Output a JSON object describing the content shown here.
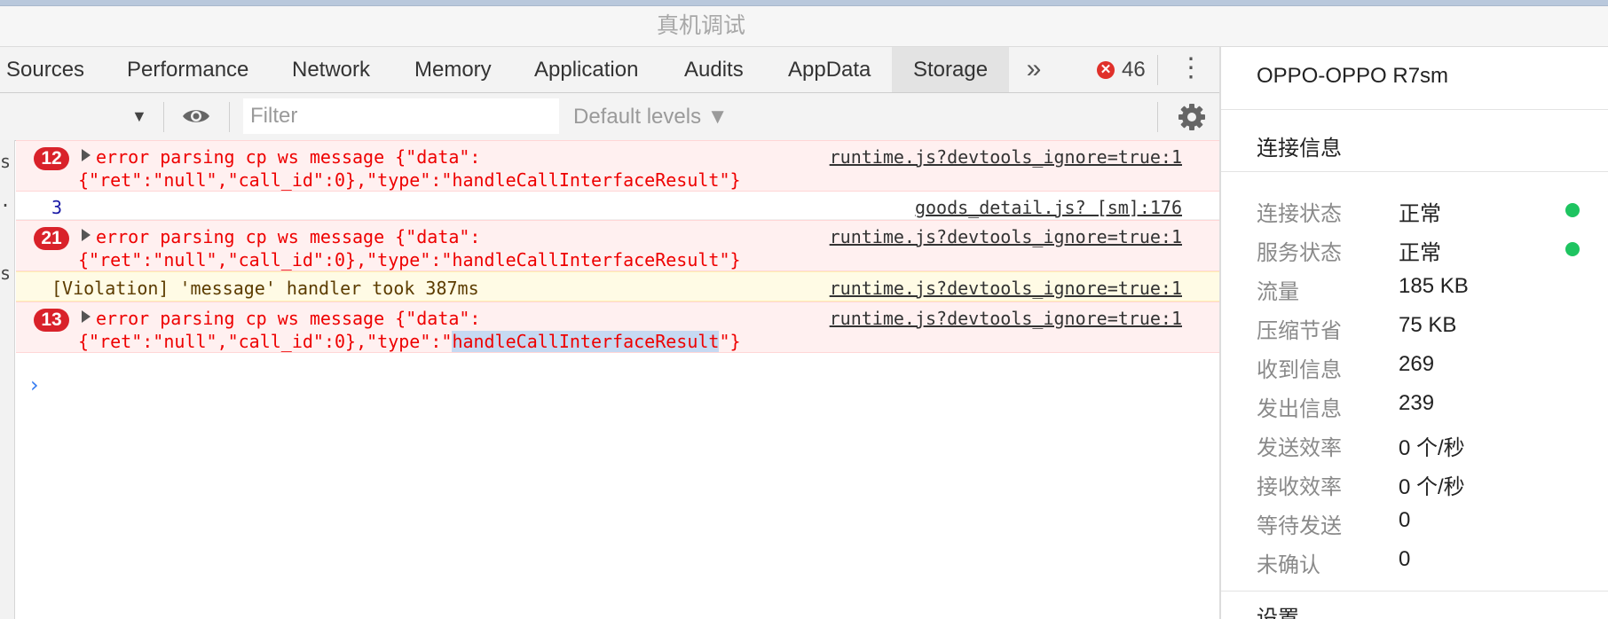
{
  "window": {
    "title": "真机调试"
  },
  "tabs": [
    {
      "label": "Sources"
    },
    {
      "label": "Performance"
    },
    {
      "label": "Network"
    },
    {
      "label": "Memory"
    },
    {
      "label": "Application"
    },
    {
      "label": "Audits"
    },
    {
      "label": "AppData"
    },
    {
      "label": "Storage",
      "active": true
    }
  ],
  "tabs_more": "»",
  "error_count": "46",
  "filter": {
    "placeholder": "Filter",
    "levels_label": "Default levels ▼"
  },
  "left_gutter": [
    "s",
    "..",
    "s"
  ],
  "console": {
    "messages": [
      {
        "type": "error",
        "count": "12",
        "line1": "error parsing cp ws message {\"data\":",
        "line2": "{\"ret\":\"null\",\"call_id\":0},\"type\":\"handleCallInterfaceResult\"}",
        "source": "runtime.js?devtools_ignore=true:1"
      },
      {
        "type": "log",
        "text": "3",
        "source": "goods_detail.js? [sm]:176"
      },
      {
        "type": "error",
        "count": "21",
        "line1": "error parsing cp ws message {\"data\":",
        "line2": "{\"ret\":\"null\",\"call_id\":0},\"type\":\"handleCallInterfaceResult\"}",
        "source": "runtime.js?devtools_ignore=true:1"
      },
      {
        "type": "warning",
        "text": "[Violation] 'message' handler took 387ms",
        "source": "runtime.js?devtools_ignore=true:1"
      },
      {
        "type": "error",
        "count": "13",
        "line1": "error parsing cp ws message {\"data\":",
        "line2_pre": "{\"ret\":\"null\",\"call_id\":0},\"type\":\"",
        "line2_selected": "handleCallInterfaceResult",
        "line2_post": "\"}",
        "source": "runtime.js?devtools_ignore=true:1"
      }
    ],
    "prompt": "›"
  },
  "sidepanel": {
    "device": "OPPO-OPPO R7sm",
    "section_title": "连接信息",
    "rows": [
      {
        "label": "连接状态",
        "value": "正常",
        "status": "ok"
      },
      {
        "label": "服务状态",
        "value": "正常",
        "status": "ok"
      },
      {
        "label": "流量",
        "value": "185 KB"
      },
      {
        "label": "压缩节省",
        "value": "75 KB"
      },
      {
        "label": "收到信息",
        "value": "269"
      },
      {
        "label": "发出信息",
        "value": "239"
      },
      {
        "label": "发送效率",
        "value": "0 个/秒"
      },
      {
        "label": "接收效率",
        "value": "0 个/秒"
      },
      {
        "label": "等待发送",
        "value": "0"
      },
      {
        "label": "未确认",
        "value": "0"
      }
    ],
    "next_section_title": "设置"
  },
  "colors": {
    "status_ok": "#1ec460",
    "error_badge": "#d9222a",
    "error_text": "#ee0000",
    "log_number": "#1a1aa6"
  }
}
